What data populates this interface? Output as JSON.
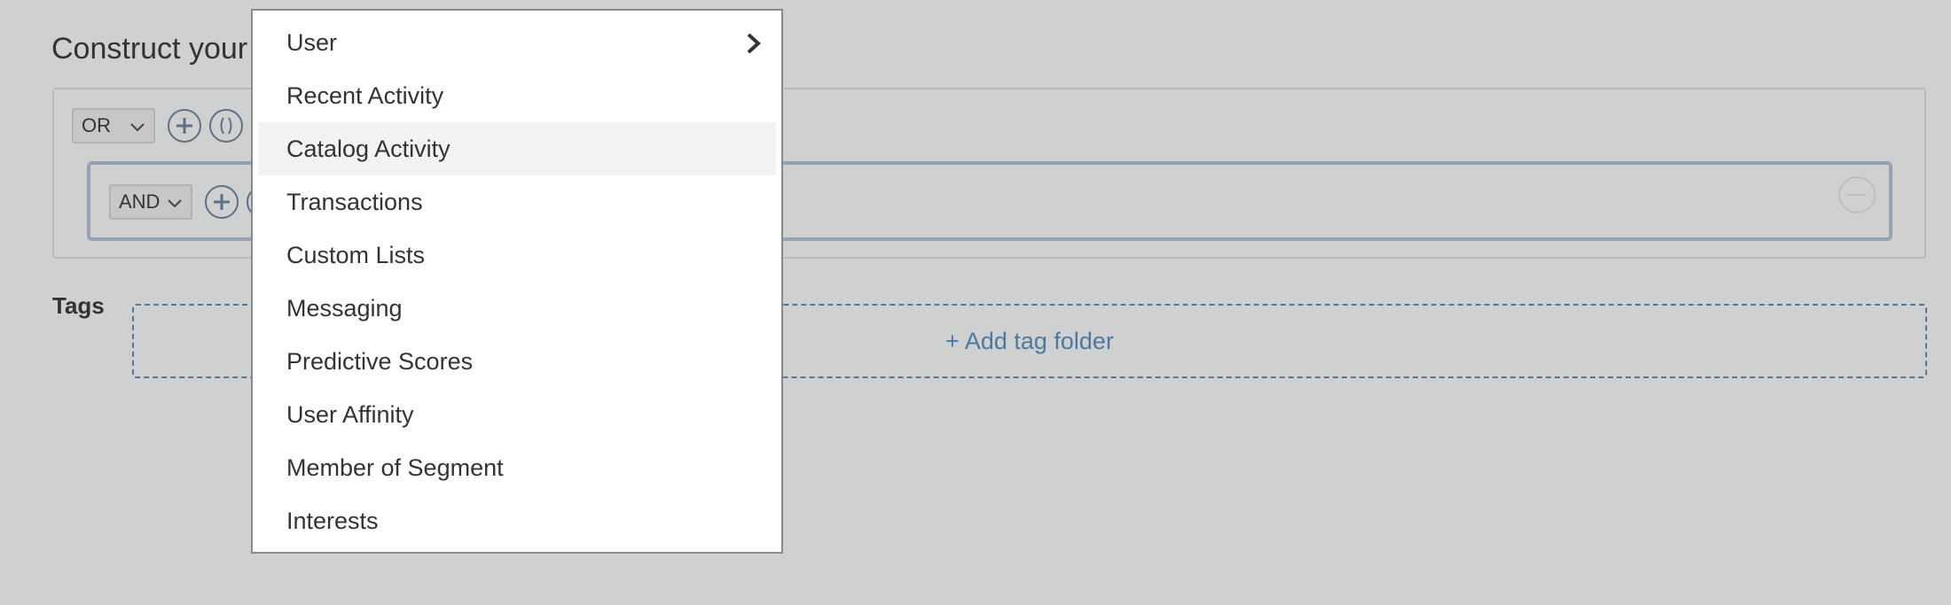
{
  "page": {
    "title": "Construct your"
  },
  "builder": {
    "outer_operator": "OR",
    "inner_operator": "AND",
    "add_filter_icon": "plus-circle-icon",
    "group_icon": "parentheses-circle-icon",
    "remove_icon": "minus-circle-icon"
  },
  "tags": {
    "label": "Tags",
    "add_folder_label": "+ Add tag folder"
  },
  "dropdown": {
    "items": [
      {
        "label": "User",
        "has_submenu": true
      },
      {
        "label": "Recent Activity"
      },
      {
        "label": "Catalog Activity",
        "highlighted": true
      },
      {
        "label": "Transactions"
      },
      {
        "label": "Custom Lists"
      },
      {
        "label": "Messaging"
      },
      {
        "label": "Predictive Scores"
      },
      {
        "label": "User Affinity"
      },
      {
        "label": "Member of Segment"
      },
      {
        "label": "Interests"
      }
    ]
  },
  "colors": {
    "background": "#cfd0d0",
    "accent": "#4f78a0",
    "group_border": "#93a2b5",
    "menu_highlight": "#f2f2f2"
  }
}
